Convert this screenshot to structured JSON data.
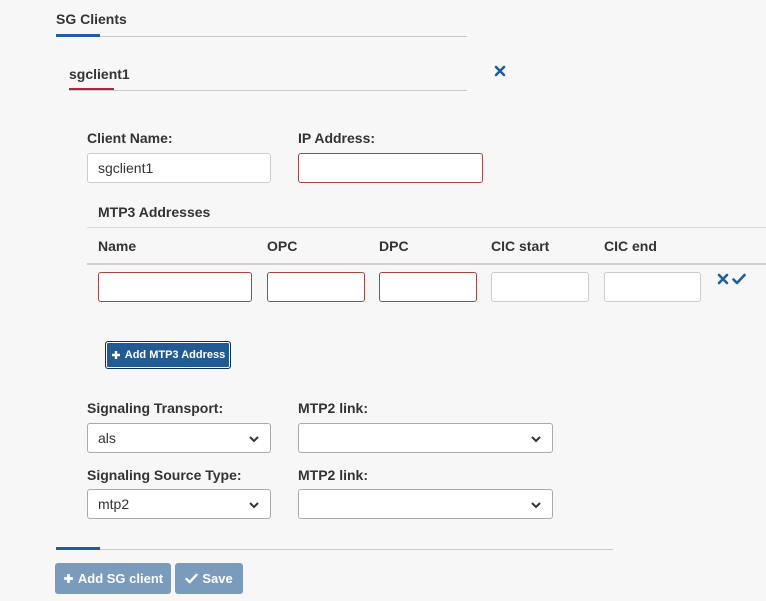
{
  "section": {
    "title": "SG Clients"
  },
  "client": {
    "header": "sgclient1",
    "remove_icon": "close-icon",
    "client_name": {
      "label": "Client Name:",
      "value": "sgclient1",
      "placeholder": ""
    },
    "ip_address": {
      "label": "IP Address:",
      "value": "",
      "placeholder": ""
    }
  },
  "mtp3": {
    "title": "MTP3 Addresses",
    "columns": [
      "Name",
      "OPC",
      "DPC",
      "CIC start",
      "CIC end"
    ],
    "row": {
      "name": "",
      "opc": "",
      "dpc": "",
      "cic_start": "",
      "cic_end": "",
      "actions": [
        "close-icon",
        "check-icon"
      ]
    },
    "add_button": {
      "label": "Add MTP3 Address",
      "icon": "plus-icon"
    }
  },
  "signaling_transport": {
    "label": "Signaling Transport:",
    "value": "als"
  },
  "mtp2_link_1": {
    "label": "MTP2 link:",
    "value": ""
  },
  "signaling_source_type": {
    "label": "Signaling Source Type:",
    "value": "mtp2"
  },
  "mtp2_link_2": {
    "label": "MTP2 link:",
    "value": ""
  },
  "footer": {
    "add_sg_client": {
      "label": "Add SG client",
      "icon": "plus-icon"
    },
    "save": {
      "label": "Save",
      "icon": "check-icon"
    }
  },
  "colors": {
    "accent_blue": "#1f5d9b",
    "accent_red": "#b0243c",
    "invalid_border": "#a94442",
    "primary_button": "#225b94",
    "disabled_button": "#7b9bbd"
  }
}
